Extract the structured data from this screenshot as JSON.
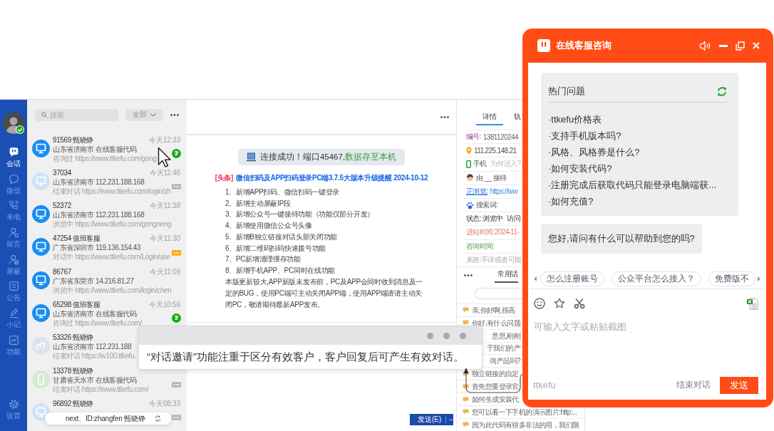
{
  "nav": {
    "user": {
      "online": true
    },
    "items": [
      {
        "label": "会话",
        "selected": true
      },
      {
        "label": "微信",
        "selected": false
      },
      {
        "label": "来电",
        "selected": false
      },
      {
        "label": "留言",
        "selected": false
      },
      {
        "label": "屏蔽",
        "selected": false
      },
      {
        "label": "公告",
        "selected": false
      },
      {
        "label": "小记",
        "selected": false
      },
      {
        "label": "功能",
        "selected": false
      }
    ],
    "settings": {
      "label": "设置"
    }
  },
  "conversation_list": {
    "search": {
      "placeholder": "搜索"
    },
    "filter": {
      "value": "全部"
    },
    "items": [
      {
        "kind": "pc",
        "online": true,
        "title": "91569 甄晓铮",
        "time": "今天12:33",
        "location": "山东省济南市 在线客服代码",
        "activity": "咨询过 https://www.ttkefu.com/gong",
        "badge": {
          "kind": "mark",
          "color": "#1aad19"
        }
      },
      {
        "kind": "pc",
        "online": false,
        "title": "37034",
        "time": "今天11:46",
        "location": "山东省济南市 112.231.188.168",
        "activity": "结束对话 https://www.ttkefu.com/login/zh",
        "badge": {
          "kind": "dots",
          "color": "#b4b4b4"
        }
      },
      {
        "kind": "pc",
        "online": true,
        "title": "52372",
        "time": "今天11:38",
        "location": "山东省济南市 112.231.188.168",
        "activity": "浏览中 https://www.ttkefu.com/gongneng"
      },
      {
        "kind": "pc",
        "online": true,
        "title": "47254 值班客服",
        "time": "今天11:30",
        "location": "广东省深圳市 119.136.154.43",
        "activity": "对话中 https://www.ttkefu.com/Login/use",
        "badge": {
          "kind": "dots",
          "color": "#ffa800"
        }
      },
      {
        "kind": "pc",
        "online": true,
        "title": "86767",
        "time": "今天11:09",
        "location": "广东省东莞市 14.216.81.27",
        "activity": "浏览中 https://www.ttkefu.com/login/chen"
      },
      {
        "kind": "pc",
        "online": true,
        "title": "65298 值班客服",
        "time": "今天10:56",
        "location": "山东省济南市 在线客服代码",
        "activity": "咨询过 https://www.ttkefu.com/",
        "badge": {
          "kind": "mark",
          "color": "#1aad19"
        }
      },
      {
        "kind": "miniprogram",
        "online": false,
        "title": "53326 甄晓铮",
        "location": "山东省济南市 112.231.188",
        "activity": "结束对话 https://w100.ttkefu."
      },
      {
        "kind": "mobile",
        "online": false,
        "title": "13378 甄晓铮",
        "location": "甘肃省天水市 在线客服代码",
        "activity": "结束对话 https://www.ttkefu.com/",
        "badge": {
          "kind": "dots",
          "color": "#b4b4b4"
        }
      },
      {
        "kind": "pc",
        "online": false,
        "title": "96892 甄晓铮",
        "time": "今天08:33",
        "badge": {
          "kind": "dots",
          "color": "#b4b4b4"
        }
      }
    ]
  },
  "chat": {
    "banner": {
      "text": "连接成功！端口45467,",
      "highlight": "数据存至本机"
    },
    "news": {
      "tag": "[头条]",
      "title": "微信扫码及APP扫码登录PC端3.7.5大版本升级提醒 2024-10-12",
      "items": [
        "1、新增APP扫码、微信扫码一键登录",
        "2、新增主动屏蔽IP段",
        "3、新增公众号一键接待功能（功能仅部分开发）",
        "4、新增使用微信公众号头像",
        "5、新增B独立链接对话头部关闭功能",
        "6、新增二维码扫码快速拨号功能",
        "7、PC新增清理缓存功能",
        "8、新增手机APP、PC同时在线功能"
      ],
      "note": "本版更新较大,APP新版未发布前，PC及APP会同时收到消息及一定的BUG，使用PC端可主动关闭APP端，使用APP端请请主动关闭PC，敬请期待最新APP发布。"
    },
    "send_button": {
      "label": "发送(E)"
    }
  },
  "details": {
    "tabs": [
      {
        "label": "详情",
        "selected": true
      },
      {
        "label": "轨",
        "selected": false
      }
    ],
    "rows": [
      {
        "kind": "id",
        "label": "编号:",
        "value": "1381120244"
      },
      {
        "kind": "ip",
        "value": "111.225.148.21"
      },
      {
        "kind": "device",
        "value": "手机",
        "hint": "为何进入?"
      },
      {
        "kind": "agent",
        "value": "由 __ 接待"
      },
      {
        "kind": "page",
        "label": "正浏览:",
        "value": "https://ww"
      },
      {
        "kind": "search",
        "value": "搜索词:"
      },
      {
        "kind": "status",
        "value": "状态: 浏览中",
        "hint": "访问"
      },
      {
        "kind": "entry",
        "value": "进站时间:2024-11-"
      },
      {
        "kind": "consult",
        "value": "咨询时间:"
      },
      {
        "kind": "source",
        "value": "来路:不详或者可能"
      }
    ],
    "phrase_tabs": [
      {
        "label": "常用话",
        "selected": true
      }
    ],
    "phrases": [
      {
        "kind": "phrase",
        "text": "亲,你好啊,很高"
      },
      {
        "kind": "phrase",
        "text": "你好,有什么问题"
      },
      {
        "kind": "fragment",
        "text": "意思,刚刚"
      },
      {
        "kind": "fragment",
        "text": "于我们的产"
      },
      {
        "kind": "fragment",
        "text": "询产品吗?"
      },
      {
        "kind": "phrase",
        "text": "独立链接的自定"
      },
      {
        "kind": "phrase",
        "text": "首先您要登录官"
      },
      {
        "kind": "phrase",
        "text": "如何生成安装代"
      },
      {
        "kind": "phrase",
        "text": "您可以看一下手机的演示图片:http:..."
      },
      {
        "kind": "phrase",
        "text": "因为此代码有很多非法的用，我们限"
      }
    ]
  },
  "chat_widget": {
    "title": "在线客服咨询",
    "faq": {
      "title": "热门问题",
      "items": [
        "·ttkefu价格表",
        "·支持手机版本吗?",
        "·风格、风格券是什么?",
        "·如何安装代码?",
        "·注册完成后获取代码只能登录电脑端获...",
        "·如何充值?"
      ]
    },
    "greeting": "您好,请问有什么可以帮助到您的吗?",
    "quick_replies": [
      "怎么注册账号",
      "公众平台怎么接入？",
      "免费版不"
    ],
    "input": {
      "placeholder": "可输入文字或粘贴截图"
    },
    "brand": "ttkefu",
    "end_button": {
      "label": "结束对话"
    },
    "send_button": {
      "label": "发送"
    }
  },
  "tip_popup": {
    "text": "“对话邀请”功能注重于区分有效客户，客户回复后可产生有效对话。"
  },
  "account_pill": {
    "text": "next、ID:zhangfen 甄晓铮"
  }
}
